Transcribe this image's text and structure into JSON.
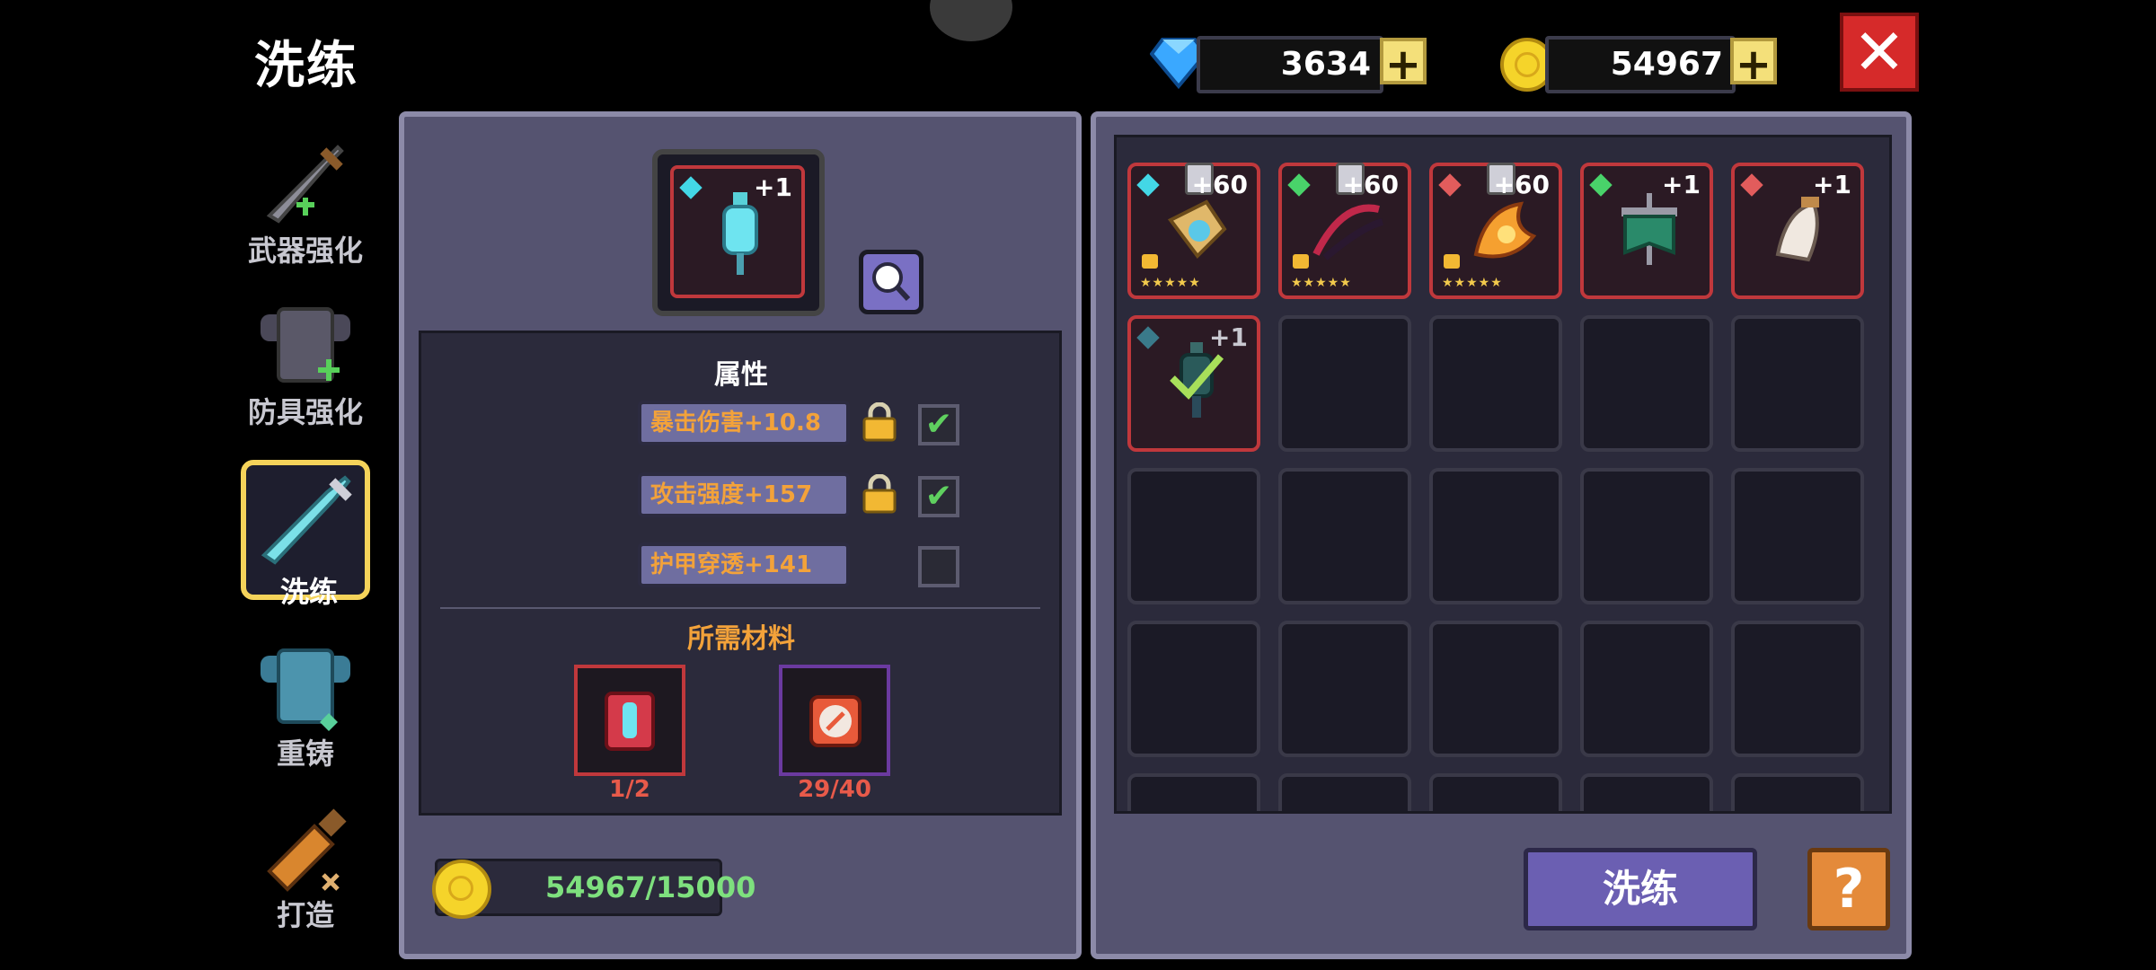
{
  "title": "洗练",
  "currency": {
    "gems": "3634",
    "gold": "54967"
  },
  "sidebar": {
    "items": [
      {
        "label": "武器强化",
        "icon": "sword-icon"
      },
      {
        "label": "防具强化",
        "icon": "armor-icon"
      },
      {
        "label": "洗练",
        "icon": "crystal-sword-icon",
        "active": true
      },
      {
        "label": "重铸",
        "icon": "blue-armor-icon"
      },
      {
        "label": "打造",
        "icon": "hammer-icon"
      }
    ]
  },
  "selected_item": {
    "plus": "+1"
  },
  "attributes": {
    "heading": "属性",
    "list": [
      {
        "label": "暴击伤害+10.8",
        "locked": true,
        "checked": true
      },
      {
        "label": "攻击强度+157",
        "locked": true,
        "checked": true
      },
      {
        "label": "护甲穿透+141",
        "locked": false,
        "checked": false
      }
    ]
  },
  "materials": {
    "heading": "所需材料",
    "items": [
      {
        "count": "1/2"
      },
      {
        "count": "29/40"
      }
    ]
  },
  "cost": {
    "gold": "54967/15000"
  },
  "inventory": [
    {
      "plus": "+60",
      "stars": "★★★★★",
      "gem": "#43d7e6"
    },
    {
      "plus": "+60",
      "stars": "★★★★★",
      "gem": "#49d36a"
    },
    {
      "plus": "+60",
      "stars": "★★★★★",
      "gem": "#e25c5c"
    },
    {
      "plus": "+1",
      "stars": "",
      "gem": "#49d36a"
    },
    {
      "plus": "+1",
      "stars": "",
      "gem": "#e25c5c"
    },
    {
      "plus": "+1",
      "stars": "",
      "gem": "#3a7a8a"
    }
  ],
  "buttons": {
    "refine": "洗练",
    "help": "?"
  },
  "colors": {
    "accent": "#6b5fb2",
    "attr_text": "#f3a23a",
    "close": "#d62a2a"
  }
}
